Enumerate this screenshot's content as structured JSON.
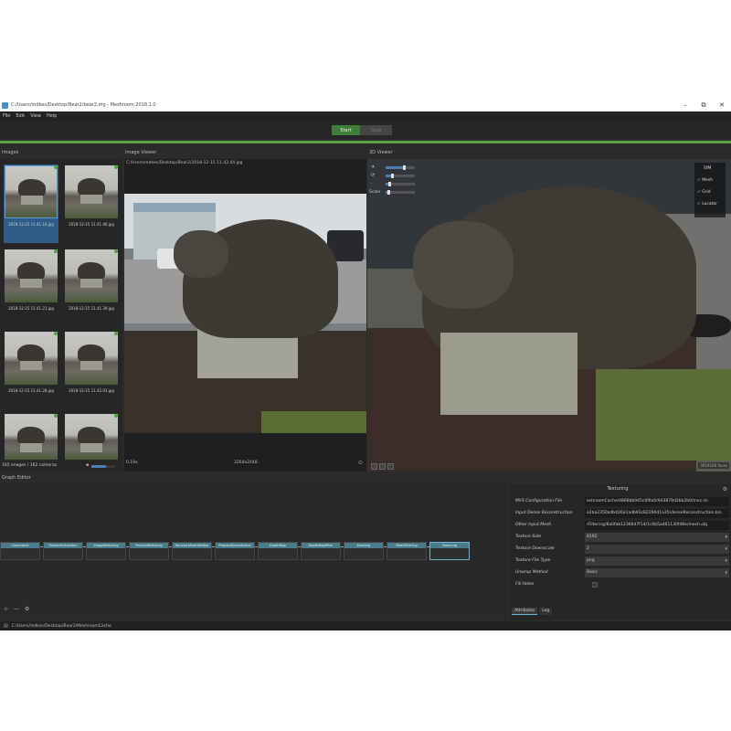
{
  "window": {
    "title": "C:/Users/mdkes/Desktop/Bear2/bear2.mg - Meshroom 2018.1.0",
    "controls": {
      "minimize": "–",
      "maximize": "⧉",
      "close": "✕"
    }
  },
  "menu": [
    "File",
    "Edit",
    "View",
    "Help"
  ],
  "toolbar": {
    "start_label": "Start",
    "stop_label": "Stop"
  },
  "images_panel": {
    "title": "Images",
    "thumbnails": [
      {
        "caption": "2018-12-15 11.41.16.jpg"
      },
      {
        "caption": "2018-12-15 11.41.46.jpg"
      },
      {
        "caption": "2018-12-15 11.41.21.jpg"
      },
      {
        "caption": "2018-12-15 11.41.39.jpg"
      },
      {
        "caption": "2018-12-15 11.41.28.jpg"
      },
      {
        "caption": "2018-12-15 11.42.03.jpg"
      }
    ],
    "footer": "165 images / 162 cameras"
  },
  "image_viewer": {
    "title": "Image Viewer",
    "path": "C:/Users/mdkes/Desktop/Bear2/2018-12-15 11.42.44.jpg",
    "zoom": "0.19x",
    "resolution": "3264x2448"
  },
  "viewer3d": {
    "title": "3D Viewer",
    "scale_label": "Scale",
    "layers": [
      "SfM",
      "Mesh",
      "Grid",
      "Locator"
    ],
    "stats": "3919168 faces"
  },
  "graph_editor": {
    "title": "Graph Editor",
    "nodes": [
      "CameraInit",
      "FeatureExtraction",
      "ImageMatching",
      "FeatureMatching",
      "StructureFromMotion",
      "PrepareDenseScene",
      "DepthMap",
      "DepthMapFilter",
      "Meshing",
      "MeshFiltering",
      "Texturing"
    ]
  },
  "attribute_editor": {
    "title": "Texturing",
    "rows": [
      {
        "key": "MVS Configuration File",
        "value": "eshroomCache/4868bb945c6f6a0/9d3879d2bb2b0/mvs.ini"
      },
      {
        "key": "Input Dense Reconstruction",
        "value": "a2ba2350a4b426a1adb93c82290d1a35/denseReconstruction.bin"
      },
      {
        "key": "Other Input Mesh",
        "value": "rFiltering/8a0fab12366d7f14/1c0b5a461130f46e/mesh.obj"
      },
      {
        "key": "Texture Side",
        "value": "8192"
      },
      {
        "key": "Texture Downscale",
        "value": "2"
      },
      {
        "key": "Texture File Type",
        "value": "png"
      },
      {
        "key": "Unwrap Method",
        "value": "Basic"
      },
      {
        "key": "Fill Holes",
        "value": ""
      }
    ],
    "tabs": [
      "Attributes",
      "Log"
    ]
  },
  "status": {
    "cache_path": "C:/Users/mdkes/Desktop/Bear2/MeshroomCache"
  }
}
